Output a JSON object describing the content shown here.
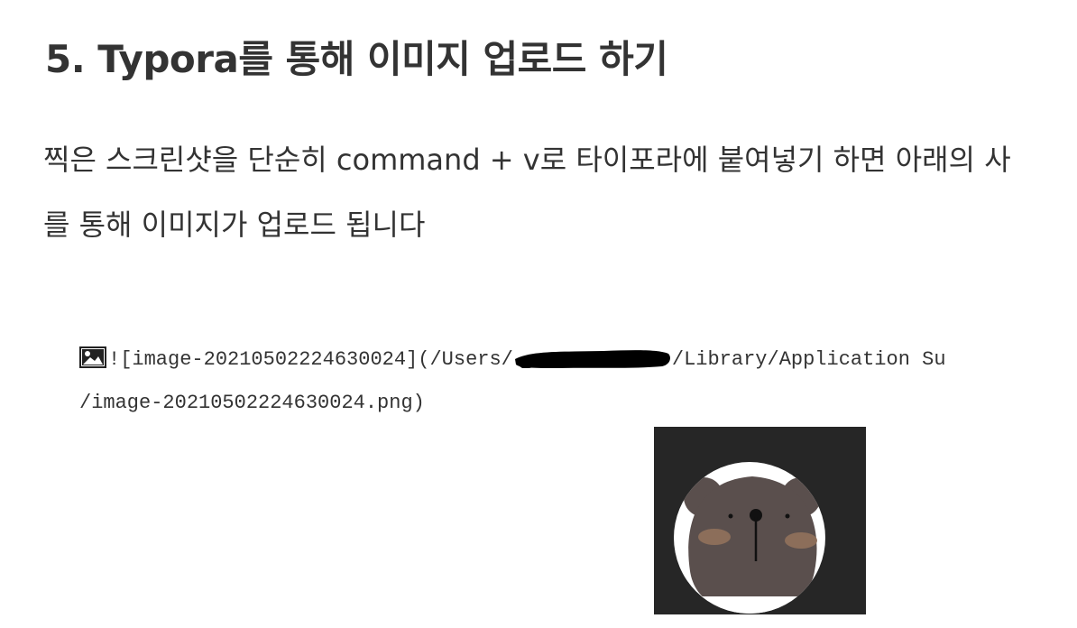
{
  "heading": "5. Typora를 통해 이미지 업로드 하기",
  "paragraph": {
    "line1": "찍은 스크린샷을 단순히 command + v로 타이포라에 붙여넣기 하면 아래의 사",
    "line2": "를 통해 이미지가 업로드 됩니다"
  },
  "code": {
    "line1_prefix": "![image-20210502224630024](/Users/",
    "line1_suffix": "/Library/Application Su",
    "line2": "/image-20210502224630024.png)"
  },
  "icons": {
    "broken_image": "image-icon",
    "avatar": "bear-avatar"
  },
  "colors": {
    "text": "#333333",
    "avatar_background": "#262626",
    "bear_fur": "#5a4f4d",
    "redaction": "#000000"
  }
}
